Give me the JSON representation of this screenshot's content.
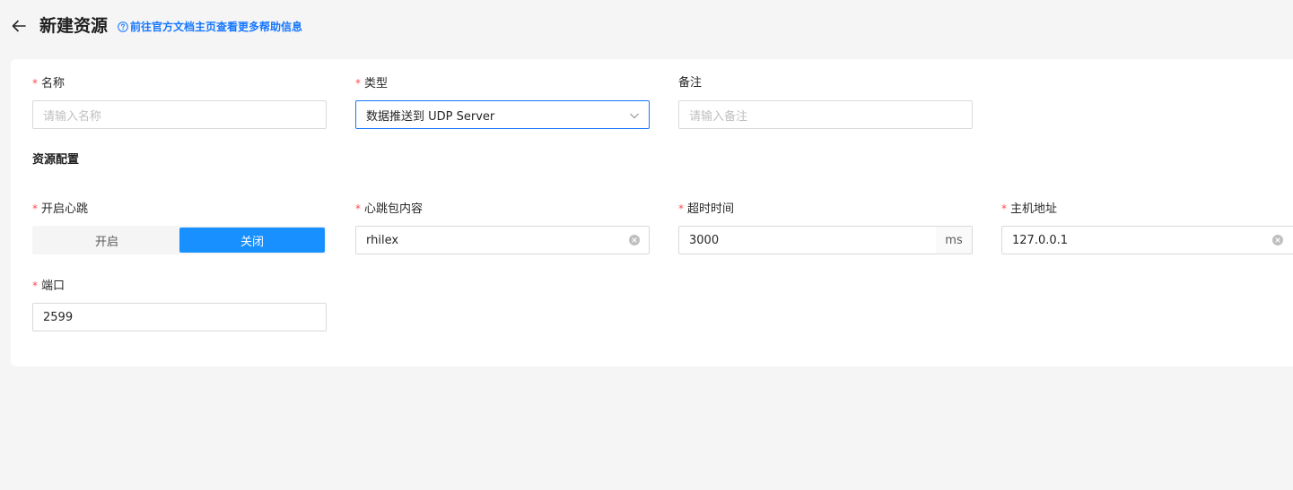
{
  "header": {
    "title": "新建资源",
    "help_link": "前往官方文档主页查看更多帮助信息"
  },
  "form": {
    "name": {
      "label": "名称",
      "required": true,
      "placeholder": "请输入名称",
      "value": ""
    },
    "type": {
      "label": "类型",
      "required": true,
      "value": "数据推送到 UDP Server"
    },
    "remark": {
      "label": "备注",
      "required": false,
      "placeholder": "请输入备注",
      "value": ""
    },
    "section_title": "资源配置",
    "heartbeat": {
      "label": "开启心跳",
      "required": true,
      "options": [
        "开启",
        "关闭"
      ],
      "selected": "关闭"
    },
    "heartbeat_content": {
      "label": "心跳包内容",
      "required": true,
      "value": "rhilex"
    },
    "timeout": {
      "label": "超时时间",
      "required": true,
      "value": "3000",
      "unit": "ms"
    },
    "host": {
      "label": "主机地址",
      "required": true,
      "value": "127.0.0.1"
    },
    "port": {
      "label": "端口",
      "required": true,
      "value": "2599"
    }
  },
  "colors": {
    "primary": "#1677ff",
    "required_mark": "#ff4d4f",
    "active_segment": "#1890ff"
  },
  "icons": {
    "back": "arrow-left-icon",
    "help": "question-circle-icon",
    "clear": "close-circle-icon",
    "dropdown": "chevron-down-icon"
  }
}
